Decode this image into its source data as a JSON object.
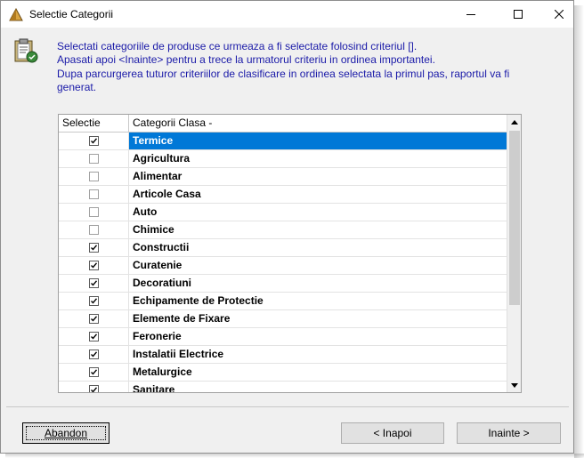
{
  "window": {
    "title": "Selectie Categorii"
  },
  "message": {
    "line1": "Selectati categoriile de produse ce urmeaza a fi selectate folosind criteriul [].",
    "line2": "Apasati apoi <Inainte> pentru a trece la urmatorul criteriu in ordinea importantei.",
    "line3": "Dupa parcurgerea tuturor criteriilor de clasificare in ordinea selectata la primul pas, raportul va fi",
    "line4": "generat."
  },
  "grid": {
    "columns": {
      "selectie": "Selectie",
      "categorii": "Categorii Clasa -"
    },
    "rows": [
      {
        "name": "Termice",
        "checked": true,
        "selected": true
      },
      {
        "name": "Agricultura",
        "checked": false
      },
      {
        "name": "Alimentar",
        "checked": false
      },
      {
        "name": "Articole Casa",
        "checked": false
      },
      {
        "name": "Auto",
        "checked": false
      },
      {
        "name": "Chimice",
        "checked": false
      },
      {
        "name": "Constructii",
        "checked": true
      },
      {
        "name": "Curatenie",
        "checked": true
      },
      {
        "name": "Decoratiuni",
        "checked": true
      },
      {
        "name": "Echipamente de Protectie",
        "checked": true
      },
      {
        "name": "Elemente de Fixare",
        "checked": true
      },
      {
        "name": "Feronerie",
        "checked": true
      },
      {
        "name": "Instalatii Electrice",
        "checked": true
      },
      {
        "name": "Metalurgice",
        "checked": true
      },
      {
        "name": "Sanitare",
        "checked": true
      }
    ]
  },
  "buttons": {
    "abandon": "Abandon",
    "inapoi": "< Inapoi",
    "inainte": "Inainte >"
  },
  "colors": {
    "selection": "#0078d7",
    "message_text": "#1a1aa8"
  }
}
